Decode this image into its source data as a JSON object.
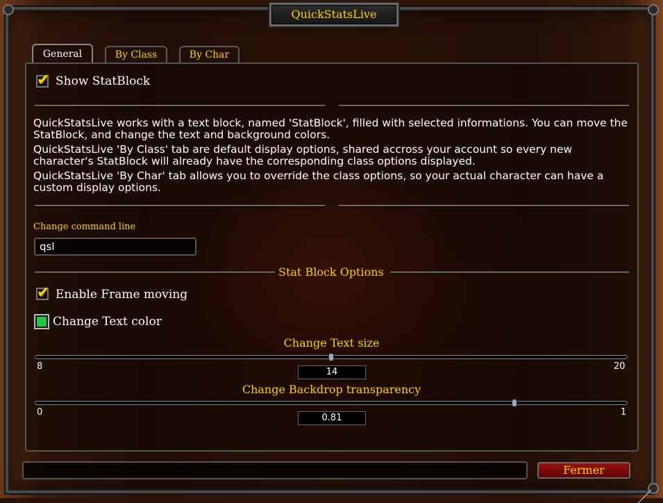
{
  "window": {
    "title": "QuickStatsLive"
  },
  "tabs": [
    {
      "label": "General",
      "active": true
    },
    {
      "label": "By Class",
      "active": false
    },
    {
      "label": "By Char",
      "active": false
    }
  ],
  "general": {
    "show_statblock": {
      "label": "Show StatBlock",
      "checked": true
    },
    "description": [
      "QuickStatsLive works with a text block, named 'StatBlock', filled with selected informations. You can move the StatBlock, and change the text and background colors.",
      "QuickStatsLive 'By Class' tab are default display options, shared accross your account so every new character's StatBlock will already have the corresponding class options displayed.",
      "QuickStatsLive 'By Char' tab allows you to override the class options, so your actual character can have a custom display options."
    ],
    "command_line": {
      "label": "Change command line",
      "value": "qsl"
    },
    "section_title": "Stat Block Options",
    "enable_frame_moving": {
      "label": "Enable Frame moving",
      "checked": true
    },
    "change_text_color": {
      "label": "Change Text color",
      "color": "#22c44a"
    },
    "text_size": {
      "label": "Change Text size",
      "min": "8",
      "max": "20",
      "value": "14",
      "min_num": 8,
      "max_num": 20,
      "value_num": 14
    },
    "backdrop": {
      "label": "Change Backdrop transparency",
      "min": "0",
      "max": "1",
      "value": "0.81",
      "min_num": 0,
      "max_num": 1,
      "value_num": 0.81
    }
  },
  "footer": {
    "close_label": "Fermer"
  },
  "colors": {
    "gold": "#ffd100",
    "close_red": "#9a1010"
  }
}
